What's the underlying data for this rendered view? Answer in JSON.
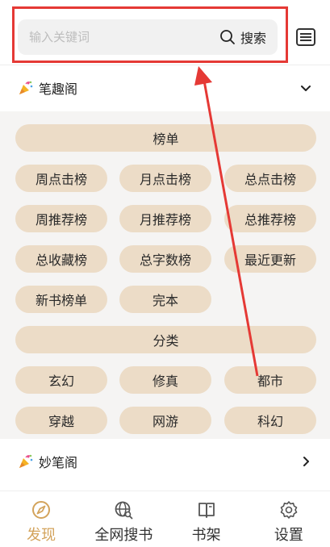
{
  "search": {
    "placeholder": "输入关键词",
    "button_label": "搜索"
  },
  "sections": [
    {
      "title": "笔趣阁",
      "expanded": true
    },
    {
      "title": "妙笔阁",
      "expanded": false
    }
  ],
  "panel": {
    "group1_label": "榜单",
    "ranking_items": [
      "周点击榜",
      "月点击榜",
      "总点击榜",
      "周推荐榜",
      "月推荐榜",
      "总推荐榜",
      "总收藏榜",
      "总字数榜",
      "最近更新",
      "新书榜单",
      "完本"
    ],
    "group2_label": "分类",
    "category_items": [
      "玄幻",
      "修真",
      "都市",
      "穿越",
      "网游",
      "科幻"
    ]
  },
  "nav": {
    "items": [
      {
        "label": "发现",
        "icon": "compass-icon",
        "active": true
      },
      {
        "label": "全网搜书",
        "icon": "globe-search-icon",
        "active": false
      },
      {
        "label": "书架",
        "icon": "book-icon",
        "active": false
      },
      {
        "label": "设置",
        "icon": "gear-icon",
        "active": false
      }
    ]
  },
  "colors": {
    "accent": "#d3a35b",
    "pill": "#ecdcc7",
    "panel_bg": "#f5f4f3",
    "highlight": "#e53935"
  }
}
